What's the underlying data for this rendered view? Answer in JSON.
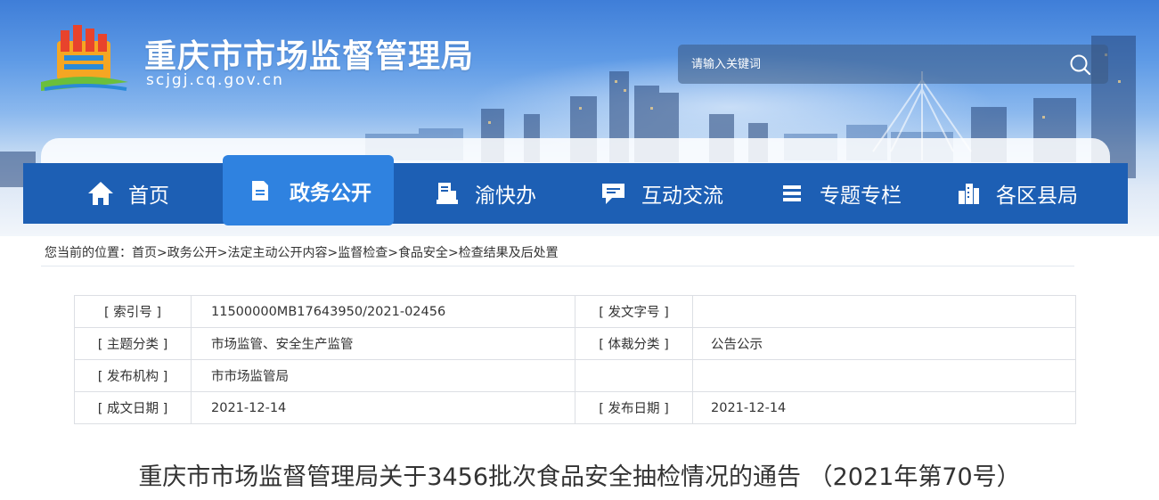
{
  "header": {
    "site_title": "重庆市市场监督管理局",
    "site_domain": "scjgj.cq.gov.cn",
    "search": {
      "placeholder": "请输入关键词"
    },
    "colors": {
      "nav_bg": "#1d5fb4",
      "nav_active": "#2f82e0",
      "logo_red": "#e8432c",
      "logo_orange": "#f5a623",
      "logo_blue": "#2b8ad8",
      "logo_green": "#6bbf3b"
    }
  },
  "nav": {
    "items": [
      {
        "label": "首页",
        "icon": "home-icon"
      },
      {
        "label": "政务公开",
        "icon": "document-icon",
        "active": true
      },
      {
        "label": "渝快办",
        "icon": "service-icon"
      },
      {
        "label": "互动交流",
        "icon": "chat-icon"
      },
      {
        "label": "专题专栏",
        "icon": "list-icon"
      },
      {
        "label": "各区县局",
        "icon": "buildings-icon"
      }
    ]
  },
  "breadcrumb": {
    "prefix": "您当前的位置：",
    "items": [
      "首页",
      "政务公开",
      "法定主动公开内容",
      "监督检查",
      "食品安全",
      "检查结果及后处置"
    ],
    "separator": ">"
  },
  "info_table": {
    "rows": [
      {
        "k1": "[ 索引号 ]",
        "v1": "11500000MB17643950/2021-02456",
        "k2": "[ 发文字号 ]",
        "v2": ""
      },
      {
        "k1": "[ 主题分类 ]",
        "v1": "市场监管、安全生产监管",
        "k2": "[ 体裁分类 ]",
        "v2": "公告公示"
      },
      {
        "k1": "[ 发布机构 ]",
        "v1": "市市场监管局",
        "k2": "",
        "v2": ""
      },
      {
        "k1": "[ 成文日期 ]",
        "v1": "2021-12-14",
        "k2": "[ 发布日期 ]",
        "v2": "2021-12-14"
      }
    ]
  },
  "article": {
    "title": "重庆市市场监督管理局关于3456批次食品安全抽检情况的通告 （2021年第70号）"
  }
}
